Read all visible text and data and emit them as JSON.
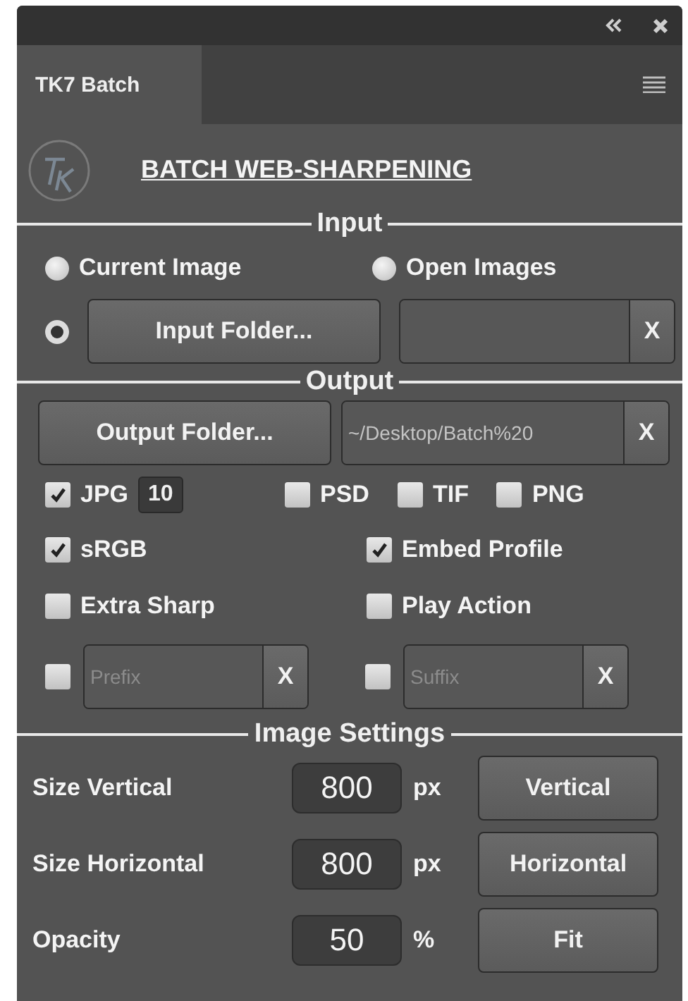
{
  "panel_tab": {
    "label": "TK7 Batch",
    "selected": true
  },
  "heading": "BATCH WEB-SHARPENING",
  "input": {
    "title": "Input",
    "sources": [
      {
        "label": "Current Image",
        "selected": false
      },
      {
        "label": "Open Images",
        "selected": false
      }
    ],
    "folder": {
      "selected": true,
      "button": "Input Folder...",
      "clear": "X"
    }
  },
  "output": {
    "title": "Output",
    "folder": {
      "button": "Output Folder...",
      "path": "~/Desktop/Batch%20",
      "clear": "X"
    },
    "formats": [
      {
        "label": "JPG",
        "checked": true,
        "quality": "10"
      },
      {
        "label": "PSD",
        "checked": false
      },
      {
        "label": "TIF",
        "checked": false
      },
      {
        "label": "PNG",
        "checked": false
      }
    ],
    "options": [
      {
        "label": "sRGB",
        "checked": true
      },
      {
        "label": "Embed Profile",
        "checked": true
      },
      {
        "label": "Extra Sharp",
        "checked": false
      },
      {
        "label": "Play Action",
        "checked": false
      }
    ],
    "affixes": [
      {
        "checked": false,
        "placeholder": "Prefix",
        "clear": "X"
      },
      {
        "checked": false,
        "placeholder": "Suffix",
        "clear": "X"
      }
    ]
  },
  "image_settings": {
    "title": "Image Settings",
    "rows": [
      {
        "label": "Size Vertical",
        "value": "800",
        "unit": "px",
        "button": "Vertical"
      },
      {
        "label": "Size Horizontal",
        "value": "800",
        "unit": "px",
        "button": "Horizontal"
      },
      {
        "label": "Opacity",
        "value": "50",
        "unit": "%",
        "button": "Fit"
      }
    ]
  }
}
